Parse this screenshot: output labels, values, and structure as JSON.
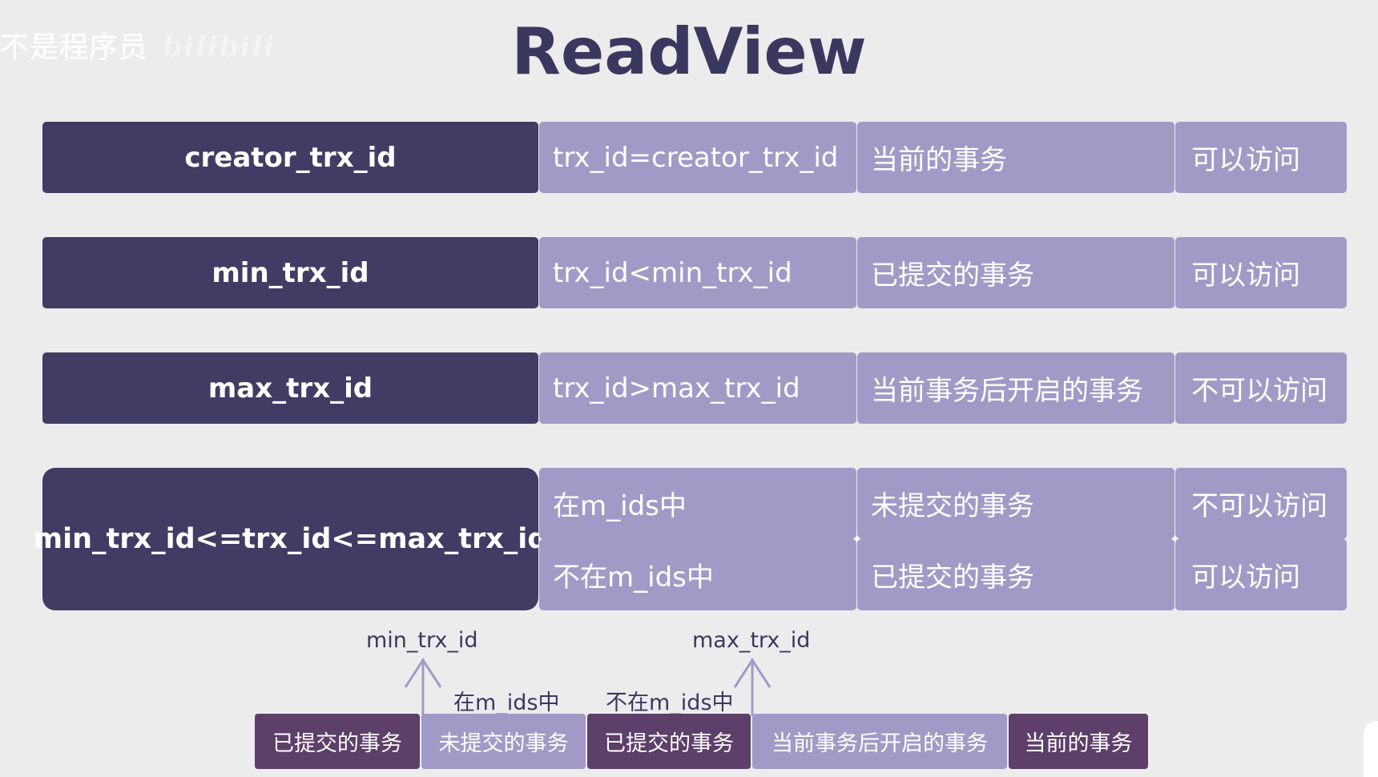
{
  "watermark": {
    "channel": "不是程序员",
    "logo": "bilibili"
  },
  "title": "ReadView",
  "rows": [
    {
      "key": "creator_trx_id",
      "condition": "trx_id=creator_trx_id",
      "description": "当前的事务",
      "access": "可以访问"
    },
    {
      "key": "min_trx_id",
      "condition": "trx_id<min_trx_id",
      "description": "已提交的事务",
      "access": "可以访问"
    },
    {
      "key": "max_trx_id",
      "condition": "trx_id>max_trx_id",
      "description": "当前事务后开启的事务",
      "access": "不可以访问"
    }
  ],
  "range_row": {
    "key": "min_trx_id<=trx_id<=max_trx_id",
    "subrows": [
      {
        "condition": "在m_ids中",
        "description": "未提交的事务",
        "access": "不可以访问"
      },
      {
        "condition": "不在m_ids中",
        "description": "已提交的事务",
        "access": "可以访问"
      }
    ]
  },
  "timeline": {
    "marker_min": "min_trx_id",
    "marker_max": "max_trx_id",
    "label_in": "在m_ids中",
    "label_not_in": "不在m_ids中",
    "segments": [
      {
        "label": "已提交的事务",
        "tone": "dark"
      },
      {
        "label": "未提交的事务",
        "tone": "light"
      },
      {
        "label": "已提交的事务",
        "tone": "dark"
      },
      {
        "label": "当前事务后开启的事务",
        "tone": "light"
      },
      {
        "label": "当前的事务",
        "tone": "dark"
      }
    ]
  },
  "colors": {
    "dark_cell": "#413c63",
    "light_cell": "#a29ac6",
    "timeline_dark": "#5d3f6a",
    "title": "#3b3860",
    "background": "#ececec"
  }
}
